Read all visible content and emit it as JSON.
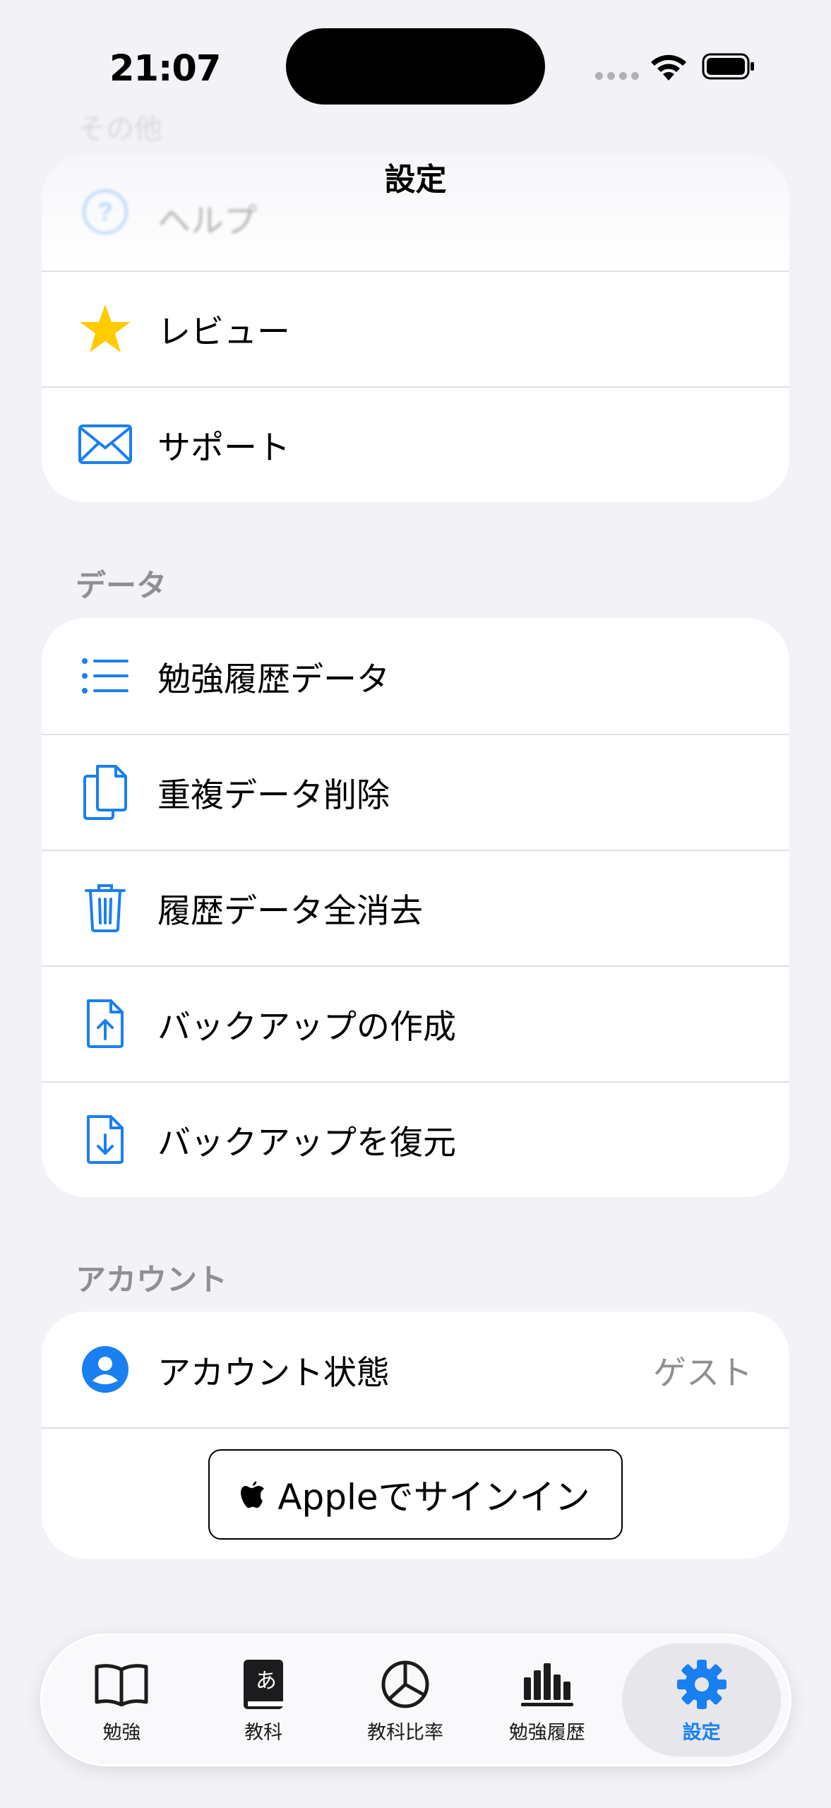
{
  "status_bar": {
    "time": "21:07"
  },
  "header": {
    "title": "設定",
    "faded_section_title": "その他"
  },
  "sections": {
    "other": {
      "rows": [
        {
          "label": "ヘルプ",
          "icon": "question-circle-icon"
        },
        {
          "label": "レビュー",
          "icon": "star-icon"
        },
        {
          "label": "サポート",
          "icon": "envelope-icon"
        }
      ]
    },
    "data": {
      "title": "データ",
      "rows": [
        {
          "label": "勉強履歴データ",
          "icon": "list-icon"
        },
        {
          "label": "重複データ削除",
          "icon": "duplicate-doc-icon"
        },
        {
          "label": "履歴データ全消去",
          "icon": "trash-icon"
        },
        {
          "label": "バックアップの作成",
          "icon": "doc-upload-icon"
        },
        {
          "label": "バックアップを復元",
          "icon": "doc-download-icon"
        }
      ]
    },
    "account": {
      "title": "アカウント",
      "status_label": "アカウント状態",
      "status_value": "ゲスト",
      "signin_button": "Appleでサインイン"
    }
  },
  "tabbar": {
    "tabs": [
      {
        "label": "勉強",
        "icon": "book-icon"
      },
      {
        "label": "教科",
        "icon": "dictionary-icon"
      },
      {
        "label": "教科比率",
        "icon": "pie-chart-icon"
      },
      {
        "label": "勉強履歴",
        "icon": "bar-chart-icon"
      },
      {
        "label": "設定",
        "icon": "gear-icon",
        "active": true
      }
    ]
  },
  "colors": {
    "accent": "#1a7ff0",
    "star": "#ffcc00",
    "background": "#f2f2f7",
    "secondary_text": "#8e8e93"
  }
}
